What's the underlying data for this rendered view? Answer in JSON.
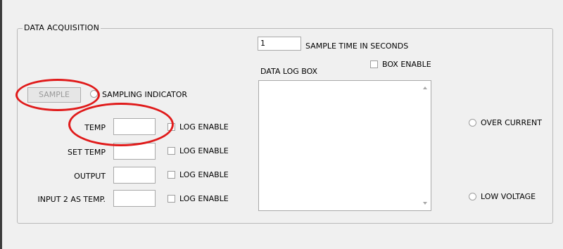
{
  "group": {
    "title": "DATA ACQUISITION"
  },
  "sample_time": {
    "value": "1",
    "label": "SAMPLE TIME IN SECONDS"
  },
  "data_log": {
    "label": "DATA LOG BOX",
    "box_enable_label": "BOX ENABLE",
    "contents": ""
  },
  "sample_button": {
    "label": "SAMPLE"
  },
  "sampling_indicator": {
    "label": "SAMPLING INDICATOR"
  },
  "channels": [
    {
      "label": "TEMP",
      "value": "",
      "log_label": "LOG ENABLE"
    },
    {
      "label": "SET TEMP",
      "value": "",
      "log_label": "LOG ENABLE"
    },
    {
      "label": "OUTPUT",
      "value": "",
      "log_label": "LOG ENABLE"
    },
    {
      "label": "INPUT 2 AS TEMP.",
      "value": "",
      "log_label": "LOG ENABLE"
    }
  ],
  "indicators": {
    "over_current": "OVER CURRENT",
    "low_voltage": "LOW VOLTAGE"
  },
  "colors": {
    "annotation": "#e01a1a",
    "window_bg": "#f0f0f0",
    "border": "#b9b9b9"
  }
}
